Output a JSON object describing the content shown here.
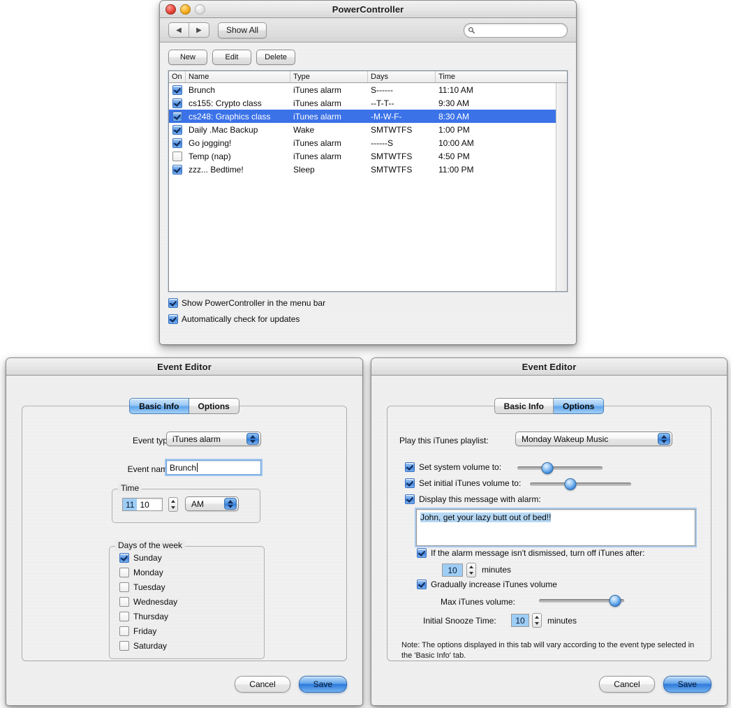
{
  "main_window": {
    "title": "PowerController",
    "traffic_lights": [
      "close",
      "minimize",
      "zoom"
    ],
    "toolbar": {
      "back_icon": "left-arrow-icon",
      "forward_icon": "right-arrow-icon",
      "show_all_label": "Show All",
      "search_placeholder": "",
      "search_value": "",
      "search_icon": "search-icon"
    },
    "buttons": {
      "new": "New",
      "edit": "Edit",
      "delete": "Delete"
    },
    "table": {
      "columns": [
        "On",
        "Name",
        "Type",
        "Days",
        "Time"
      ],
      "rows": [
        {
          "on": true,
          "name": "Brunch",
          "type": "iTunes alarm",
          "days": "S------",
          "time": "11:10 AM",
          "selected": false
        },
        {
          "on": true,
          "name": "cs155: Crypto class",
          "type": "iTunes alarm",
          "days": "--T-T--",
          "time": "9:30 AM",
          "selected": false
        },
        {
          "on": true,
          "name": "cs248: Graphics class",
          "type": "iTunes alarm",
          "days": "-M-W-F-",
          "time": "8:30 AM",
          "selected": true
        },
        {
          "on": true,
          "name": "Daily .Mac Backup",
          "type": "Wake",
          "days": "SMTWTFS",
          "time": "1:00 PM",
          "selected": false
        },
        {
          "on": true,
          "name": "Go jogging!",
          "type": "iTunes alarm",
          "days": "------S",
          "time": "10:00 AM",
          "selected": false
        },
        {
          "on": false,
          "name": "Temp (nap)",
          "type": "iTunes alarm",
          "days": "SMTWTFS",
          "time": "4:50 PM",
          "selected": false
        },
        {
          "on": true,
          "name": "zzz... Bedtime!",
          "type": "Sleep",
          "days": "SMTWTFS",
          "time": "11:00 PM",
          "selected": false
        }
      ]
    },
    "preferences": [
      {
        "label": "Show PowerController in the menu bar",
        "checked": true
      },
      {
        "label": "Automatically check for updates",
        "checked": true
      }
    ]
  },
  "editor_left": {
    "title": "Event Editor",
    "tabs": [
      {
        "label": "Basic Info",
        "active": true
      },
      {
        "label": "Options",
        "active": false
      }
    ],
    "event_type_label": "Event type:",
    "event_type_value": "iTunes alarm",
    "event_name_label": "Event name:",
    "event_name_value": "Brunch",
    "time_group_title": "Time",
    "time_hour": "11",
    "time_minute": "10",
    "time_meridiem": "AM",
    "days_group_title": "Days of the week",
    "days": [
      {
        "label": "Sunday",
        "checked": true
      },
      {
        "label": "Monday",
        "checked": false
      },
      {
        "label": "Tuesday",
        "checked": false
      },
      {
        "label": "Wednesday",
        "checked": false
      },
      {
        "label": "Thursday",
        "checked": false
      },
      {
        "label": "Friday",
        "checked": false
      },
      {
        "label": "Saturday",
        "checked": false
      }
    ],
    "cancel_label": "Cancel",
    "save_label": "Save"
  },
  "editor_right": {
    "title": "Event Editor",
    "tabs": [
      {
        "label": "Basic Info",
        "active": false
      },
      {
        "label": "Options",
        "active": true
      }
    ],
    "playlist_label": "Play this iTunes playlist:",
    "playlist_value": "Monday Wakeup Music",
    "system_volume_label": "Set system volume to:",
    "system_volume_checked": true,
    "system_volume_percent": 35,
    "itunes_volume_label": "Set initial iTunes volume to:",
    "itunes_volume_checked": true,
    "itunes_volume_percent": 40,
    "display_message_label": "Display this message with alarm:",
    "display_message_checked": true,
    "alarm_message": "John, get your lazy butt out of bed!!",
    "turn_off_label": "If the alarm message isn't dismissed, turn off iTunes after:",
    "turn_off_checked": true,
    "turn_off_minutes": "10",
    "turn_off_units": "minutes",
    "gradual_label": "Gradually increase iTunes volume",
    "gradual_checked": true,
    "max_volume_label": "Max iTunes volume:",
    "max_volume_percent": 89,
    "snooze_label": "Initial Snooze Time:",
    "snooze_value": "10",
    "snooze_units": "minutes",
    "note": "Note: The options displayed in this tab will vary according to the event type selected in the 'Basic Info' tab.",
    "cancel_label": "Cancel",
    "save_label": "Save"
  }
}
